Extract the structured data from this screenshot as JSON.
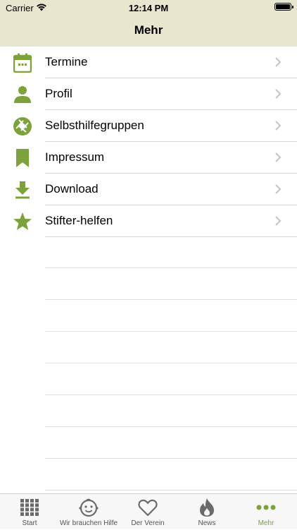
{
  "status_bar": {
    "carrier": "Carrier",
    "time": "12:14 PM"
  },
  "nav": {
    "title": "Mehr"
  },
  "colors": {
    "accent": "#7ca23b",
    "header": "#e8e6cf"
  },
  "menu": [
    {
      "label": "Termine",
      "icon": "calendar-icon"
    },
    {
      "label": "Profil",
      "icon": "person-icon"
    },
    {
      "label": "Selbsthilfegruppen",
      "icon": "aperture-icon"
    },
    {
      "label": "Impressum",
      "icon": "bookmark-icon"
    },
    {
      "label": "Download",
      "icon": "download-icon"
    },
    {
      "label": "Stifter-helfen",
      "icon": "star-icon"
    }
  ],
  "tabs": [
    {
      "label": "Start",
      "icon": "grid-icon"
    },
    {
      "label": "Wir brauchen Hilfe",
      "icon": "baby-face-icon"
    },
    {
      "label": "Der Verein",
      "icon": "heart-icon"
    },
    {
      "label": "News",
      "icon": "flame-icon"
    },
    {
      "label": "Mehr",
      "icon": "more-dots-icon",
      "active": true
    }
  ]
}
